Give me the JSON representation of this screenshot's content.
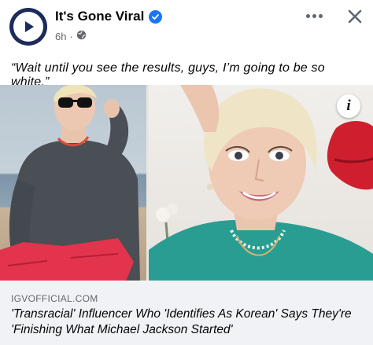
{
  "post": {
    "page_name": "It's Gone Viral",
    "timestamp": "6h",
    "audience_icon": "globe-icon",
    "caption": "“Wait until you see the results, guys, I’m going to be so white.”"
  },
  "link_preview": {
    "domain": "IGVOFFICIAL.COM",
    "headline": "'Transracial' Influencer Who 'Identifies As Korean' Says They're 'Finishing What Michael Jackson Started'"
  },
  "colors": {
    "verified": "#1877f2",
    "avatar_bg": "#1c2b5a",
    "secondary_text": "#65676b",
    "preview_bg": "#f0f2f5"
  }
}
